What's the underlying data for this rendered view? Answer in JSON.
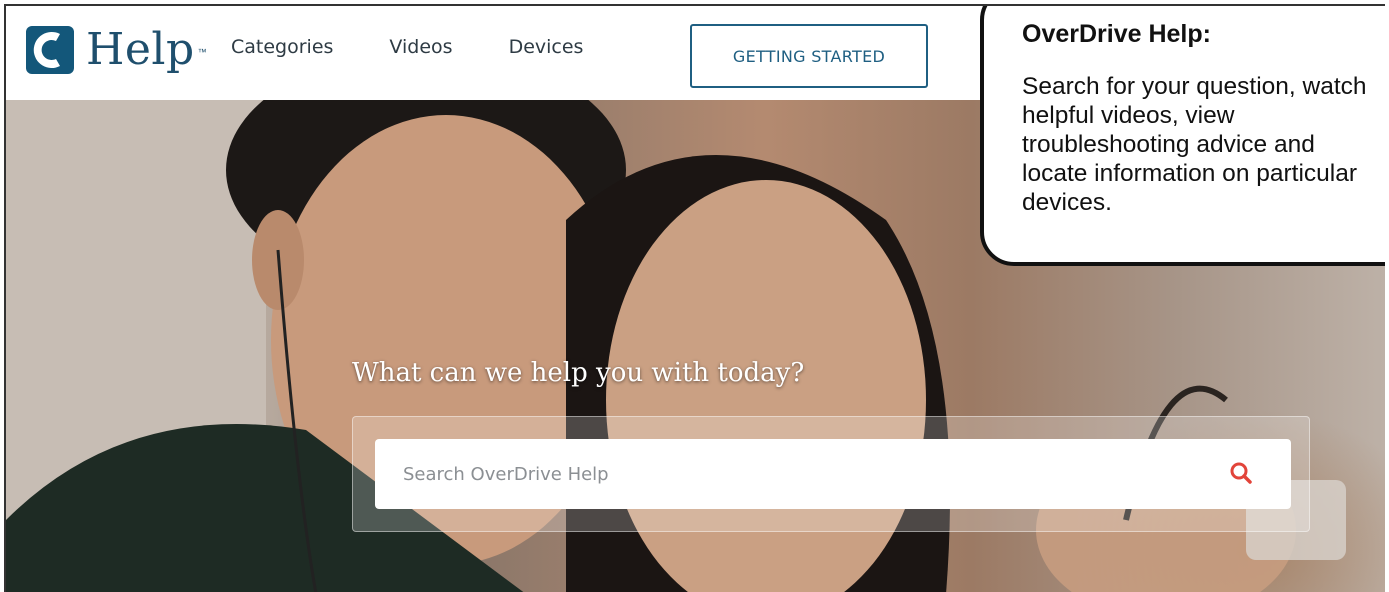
{
  "header": {
    "logo_text": "Help",
    "logo_tm": "™",
    "nav": [
      {
        "label": "Categories"
      },
      {
        "label": "Videos"
      },
      {
        "label": "Devices"
      }
    ],
    "getting_started_label": "GETTING STARTED"
  },
  "hero": {
    "title": "What can we help you with today?",
    "search": {
      "placeholder": "Search OverDrive Help",
      "value": ""
    },
    "icon": "search-icon"
  },
  "callout": {
    "title": "OverDrive Help:",
    "body": "Search for your question, watch helpful videos, view troubleshooting advice and locate information on particular devices."
  },
  "colors": {
    "brand": "#1f4f6d",
    "button_border": "#1f5f82",
    "search_icon": "#e2443a"
  }
}
